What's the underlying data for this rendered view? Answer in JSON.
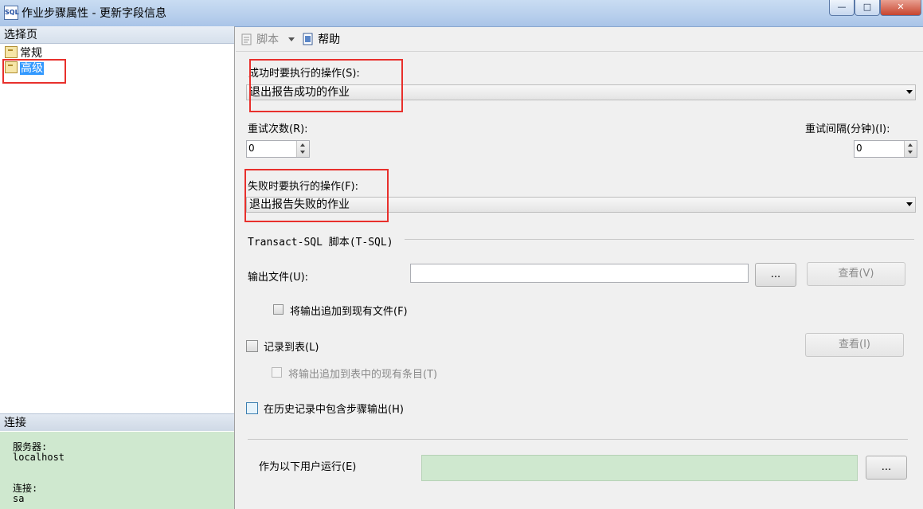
{
  "window": {
    "icon_text": "SQL",
    "title": "作业步骤属性 - 更新字段信息",
    "buttons": {
      "minimize": "—",
      "maximize": "□",
      "close": "✕"
    }
  },
  "left_pane": {
    "select_page_header": "选择页",
    "pages": [
      {
        "label": "常规",
        "selected": false
      },
      {
        "label": "高级",
        "selected": true
      }
    ],
    "connection": {
      "header": "连接",
      "server_label": "服务器:",
      "server_value": "localhost",
      "connection_label": "连接:",
      "connection_value": "sa"
    }
  },
  "toolbar": {
    "script_label": "脚本",
    "help_label": "帮助",
    "icons": [
      "script-icon",
      "dropdown-arrow-icon",
      "help-icon"
    ]
  },
  "form": {
    "on_success_label": "成功时要执行的操作(S):",
    "on_success_value": "退出报告成功的作业",
    "retry_attempts_label": "重试次数(R):",
    "retry_attempts_value": "0",
    "retry_interval_label": "重试间隔(分钟)(I):",
    "retry_interval_value": "0",
    "on_failure_label": "失败时要执行的操作(F):",
    "on_failure_value": "退出报告失败的作业",
    "tsql_section_label": "Transact-SQL 脚本(T-SQL)",
    "output_file_label": "输出文件(U):",
    "output_file_value": "",
    "browse_button": "...",
    "view_output_button": "查看(V)",
    "append_output_label": "将输出追加到现有文件(F)",
    "log_to_table_label": "记录到表(L)",
    "view_table_button": "查看(I)",
    "append_table_label": "将输出追加到表中的现有条目(T)",
    "include_history_label": "在历史记录中包含步骤输出(H)",
    "run_as_label": "作为以下用户运行(E)",
    "run_as_value": "",
    "run_as_browse_button": "..."
  },
  "colors": {
    "annotation_red": "#e8302c",
    "selection_blue": "#3399ff",
    "connection_green": "#cfe8cf"
  }
}
